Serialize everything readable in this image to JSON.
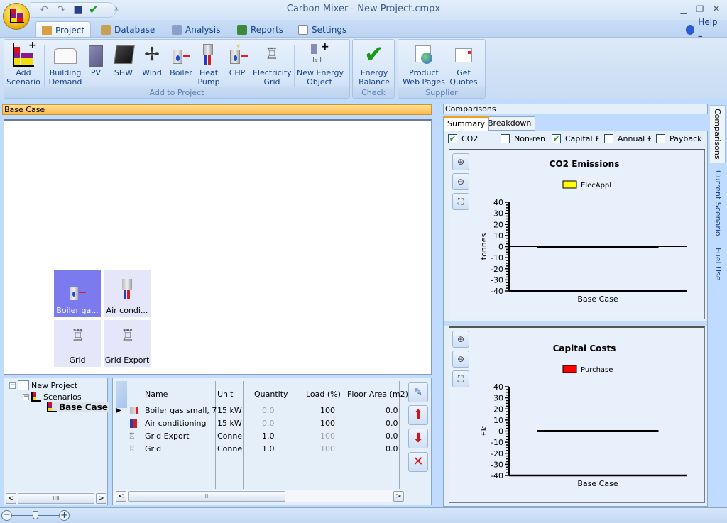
{
  "window": {
    "title": "Carbon Mixer - New Project.cmpx",
    "minimize_icon": "minimize-icon",
    "restore_icon": "restore-icon",
    "close_icon": "close-icon"
  },
  "qat": {
    "undo": "↶",
    "redo": "↷",
    "save": "■",
    "check": "✔",
    "customize": "⩡"
  },
  "tabs": [
    {
      "label": "Project",
      "icon": "home-icon",
      "active": true
    },
    {
      "label": "Database",
      "icon": "database-icon"
    },
    {
      "label": "Analysis",
      "icon": "calculator-icon"
    },
    {
      "label": "Reports",
      "icon": "book-icon"
    },
    {
      "label": "Settings",
      "icon": "settings-icon"
    }
  ],
  "help": {
    "label": "Help ▾"
  },
  "ribbon": {
    "groups": [
      {
        "label": "Add to Project"
      },
      {
        "label": "Check"
      },
      {
        "label": "Supplier"
      }
    ],
    "buttons": {
      "add_scenario": "Add\nScenario",
      "building_demand": "Building\nDemand",
      "pv": "PV",
      "shw": "SHW",
      "wind": "Wind",
      "boiler": "Boiler",
      "heat_pump": "Heat\nPump",
      "chp": "CHP",
      "electricity_grid": "Electricity\nGrid",
      "new_energy_object": "New Energy\nObject",
      "energy_balance": "Energy\nBalance",
      "product_web_pages": "Product\nWeb Pages",
      "get_quotes": "Get\nQuotes"
    }
  },
  "scenario": {
    "header": "Base Case",
    "tiles": [
      {
        "label": "Boiler ga...",
        "selected": true
      },
      {
        "label": "Air condi..."
      },
      {
        "label": "Grid"
      },
      {
        "label": "Grid Export"
      }
    ]
  },
  "tree": {
    "root": "New Project",
    "scenarios": "Scenarios",
    "base_case": "Base Case",
    "expand_symbol": "−"
  },
  "grid": {
    "columns": [
      "Name",
      "Unit",
      "Quantity",
      "Load (%)",
      "Floor Area (m2)"
    ],
    "rows": [
      {
        "name": "Boiler gas small, 7",
        "unit": "15 kW",
        "quantity": "0.0",
        "load": "100",
        "floor_area": "0.0",
        "current": true
      },
      {
        "name": "Air conditioning",
        "unit": "15 kW",
        "quantity": "0.0",
        "load": "100",
        "floor_area": "0.0"
      },
      {
        "name": "Grid Export",
        "unit": "Conne",
        "quantity": "1.0",
        "load": "100",
        "floor_area": "0.0"
      },
      {
        "name": "Grid",
        "unit": "Conne",
        "quantity": "1.0",
        "load": "100",
        "floor_area": "0.0"
      }
    ],
    "row_pointer": "▶",
    "side_buttons": {
      "edit": "✎",
      "up": "⬆",
      "down": "⬇",
      "delete": "✕"
    }
  },
  "scroll": {
    "left": "<",
    "right": ">",
    "grip": "IIII"
  },
  "comparisons": {
    "header": "Comparisons",
    "tabs": [
      "Summary",
      "Breakdown"
    ],
    "checks": [
      {
        "label": "CO2",
        "checked": true
      },
      {
        "label": "Non-ren",
        "checked": false
      },
      {
        "label": "Capital £",
        "checked": true
      },
      {
        "label": "Annual £",
        "checked": false
      },
      {
        "label": "Payback",
        "checked": false
      }
    ],
    "check_mark": "✔"
  },
  "zoom_buttons": {
    "in": "⊕",
    "out": "⊖",
    "fit": "⛶"
  },
  "side_tabs": [
    "Comparisons",
    "Current Scenario",
    "Fuel Use"
  ],
  "statusbar": {
    "zoom_out": "−",
    "zoom_in": "+",
    "zoom_level_fraction": 0.5
  },
  "chart_data": [
    {
      "type": "bar",
      "title": "CO2 Emissions",
      "categories": [
        "Base Case"
      ],
      "series": [
        {
          "name": "ElecAppl",
          "color": "#ffff00",
          "values": [
            0
          ]
        }
      ],
      "xlabel": "",
      "ylabel": "tonnes",
      "ylim": [
        -40,
        40
      ],
      "yticks": [
        40,
        30,
        20,
        10,
        0,
        -10,
        -20,
        -30,
        -40
      ],
      "legend": "top-center",
      "grid": false
    },
    {
      "type": "bar",
      "title": "Capital Costs",
      "categories": [
        "Base Case"
      ],
      "series": [
        {
          "name": "Purchase",
          "color": "#ff0000",
          "values": [
            0
          ]
        }
      ],
      "xlabel": "",
      "ylabel": "£k",
      "ylim": [
        -40,
        40
      ],
      "yticks": [
        40,
        30,
        20,
        10,
        0,
        -10,
        -20,
        -30,
        -40
      ],
      "legend": "top-center",
      "grid": false
    }
  ]
}
